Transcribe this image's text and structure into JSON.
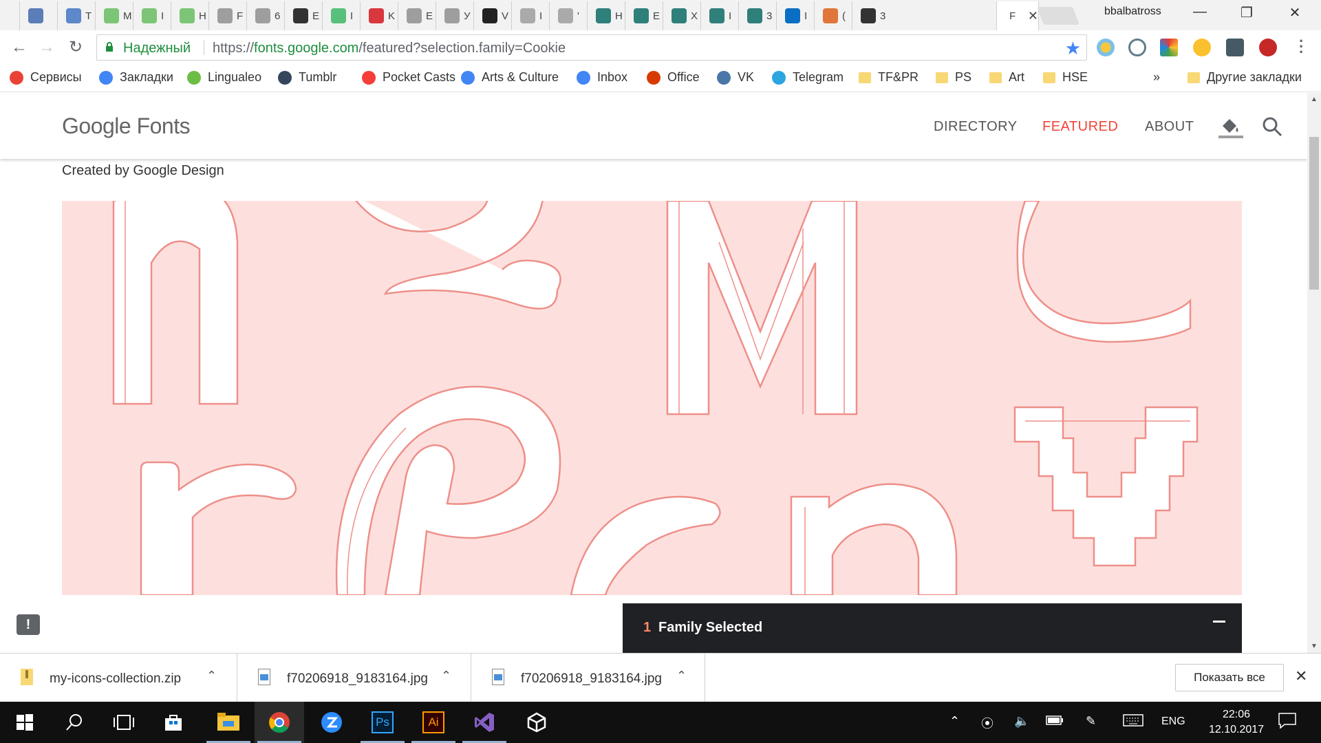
{
  "browser": {
    "tabs": [
      {
        "title": "",
        "color": "#5b7db8"
      },
      {
        "title": "T",
        "color": "#5d88c9"
      },
      {
        "title": "M",
        "color": "#7cc576"
      },
      {
        "title": "I",
        "color": "#7cc576"
      },
      {
        "title": "H",
        "color": "#7cc576"
      },
      {
        "title": "F",
        "color": "#9e9e9e"
      },
      {
        "title": "6",
        "color": "#9e9e9e"
      },
      {
        "title": "E",
        "color": "#333333"
      },
      {
        "title": "I",
        "color": "#58c07a"
      },
      {
        "title": "K",
        "color": "#d9363e"
      },
      {
        "title": "E",
        "color": "#9e9e9e"
      },
      {
        "title": "У",
        "color": "#9e9e9e"
      },
      {
        "title": "V",
        "color": "#222222"
      },
      {
        "title": "I",
        "color": "#aaaaaa"
      },
      {
        "title": "'",
        "color": "#aaaaaa"
      },
      {
        "title": "H",
        "color": "#2f7f7a"
      },
      {
        "title": "E",
        "color": "#2f7f7a"
      },
      {
        "title": "X",
        "color": "#2f7f7a"
      },
      {
        "title": "I",
        "color": "#2f7f7a"
      },
      {
        "title": "3",
        "color": "#2f7f7a"
      },
      {
        "title": "I",
        "color": "#0b6ec5"
      },
      {
        "title": "(",
        "color": "#e0763b"
      },
      {
        "title": "3",
        "color": "#333333"
      }
    ],
    "active_tab": {
      "title": "F",
      "close": "✕"
    },
    "profile_name": "bbalbatross",
    "window_controls": {
      "minimize": "—",
      "restore": "❐",
      "close": "✕"
    },
    "secure_label": "Надежный",
    "url_prefix": "https://",
    "url_host": "fonts.google.com",
    "url_path": "/featured?selection.family=Cookie",
    "bookmarks": [
      {
        "label": "Сервисы",
        "icon": "apps-grid-icon",
        "color": "#ea4335"
      },
      {
        "label": "Закладки",
        "icon": "google-icon",
        "color": "#4285f4"
      },
      {
        "label": "Lingualeo",
        "icon": "lingualeo-icon",
        "color": "#6cbd45"
      },
      {
        "label": "Tumblr",
        "icon": "tumblr-icon",
        "color": "#35465c"
      },
      {
        "label": "Pocket Casts",
        "icon": "pocketcasts-icon",
        "color": "#f43e37"
      },
      {
        "label": "Arts & Culture",
        "icon": "arts-culture-icon",
        "color": "#4285f4"
      },
      {
        "label": "Inbox",
        "icon": "inbox-icon",
        "color": "#4285f4"
      },
      {
        "label": "Office",
        "icon": "office-icon",
        "color": "#d83b01"
      },
      {
        "label": "VK",
        "icon": "vk-icon",
        "color": "#4a76a8"
      },
      {
        "label": "Telegram",
        "icon": "telegram-icon",
        "color": "#2ca5e0"
      },
      {
        "label": "TF&PR",
        "icon": "folder-icon",
        "color": "#f8d775"
      },
      {
        "label": "PS",
        "icon": "folder-icon",
        "color": "#f8d775"
      },
      {
        "label": "Art",
        "icon": "folder-icon",
        "color": "#f8d775"
      },
      {
        "label": "HSE",
        "icon": "folder-icon",
        "color": "#f8d775"
      }
    ],
    "bookmarks_overflow": "»",
    "other_bookmarks": "Другие закладки"
  },
  "page": {
    "logo": "Google Fonts",
    "nav": [
      {
        "label": "DIRECTORY",
        "active": false
      },
      {
        "label": "FEATURED",
        "active": true
      },
      {
        "label": "ABOUT",
        "active": false
      }
    ],
    "accent_color": "#f44336",
    "created_by": "Created by Google Design",
    "hero_bg_color": "#fde0de",
    "hero_line_color": "#ee8f89",
    "family_bar": {
      "count": "1",
      "label": "Family Selected"
    },
    "feedback_icon": "!"
  },
  "downloads": {
    "items": [
      {
        "name": "my-icons-collection.zip",
        "icon": "zip-file-icon"
      },
      {
        "name": "f70206918_9183164.jpg",
        "icon": "image-file-icon"
      },
      {
        "name": "f70206918_9183164.jpg",
        "icon": "image-file-icon"
      }
    ],
    "show_all": "Показать все",
    "close": "✕"
  },
  "taskbar": {
    "apps": [
      "start",
      "search",
      "task-view",
      "store",
      "file-explorer",
      "chrome",
      "zoom",
      "photoshop",
      "illustrator",
      "visual-studio",
      "unity"
    ],
    "language": "ENG",
    "time": "22:06",
    "date": "12.10.2017"
  }
}
